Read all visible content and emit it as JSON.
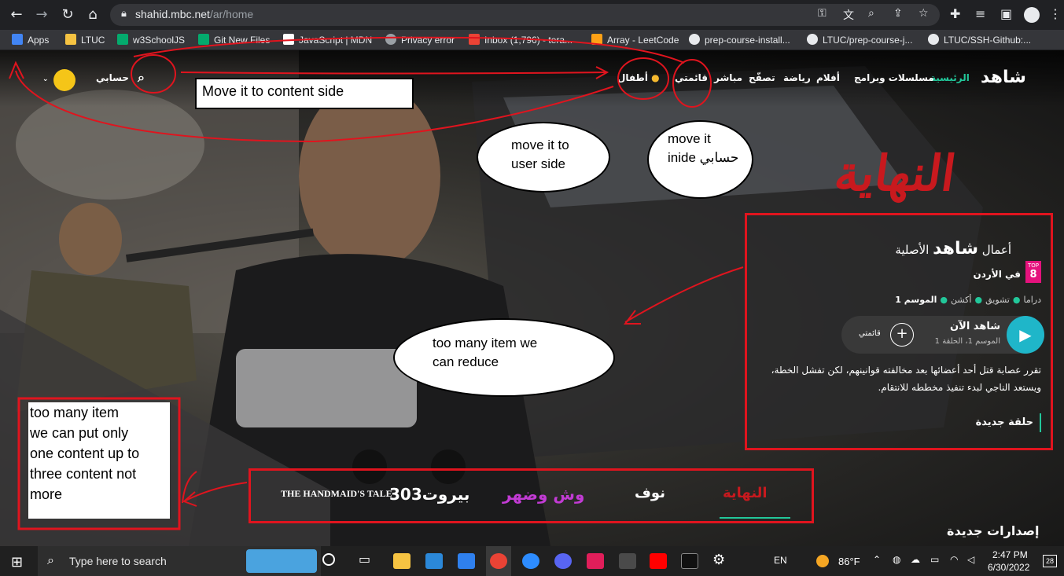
{
  "browser": {
    "url_host": "shahid.mbc.net",
    "url_path": "/ar/home",
    "bookmarks": [
      {
        "label": "Apps",
        "color": "#4285f4"
      },
      {
        "label": "LTUC",
        "color": "#f6c342"
      },
      {
        "label": "w3SchoolJS",
        "color": "#04aa6d"
      },
      {
        "label": "Git New Files",
        "color": "#04aa6d"
      },
      {
        "label": "JavaScript | MDN",
        "color": "#ffffff"
      },
      {
        "label": "Privacy error",
        "color": "#9aa0a6"
      },
      {
        "label": "Inbox (1,796) - tera...",
        "color": "#ea4335"
      },
      {
        "label": "Array - LeetCode",
        "color": "#ffa116"
      },
      {
        "label": "prep-course-install...",
        "color": "#e8eaed"
      },
      {
        "label": "LTUC/prep-course-j...",
        "color": "#e8eaed"
      },
      {
        "label": "LTUC/SSH-Github:...",
        "color": "#e8eaed"
      }
    ]
  },
  "site": {
    "logo": "شاهد",
    "nav": {
      "home": "الرئيسية",
      "series": "مسلسلات وبرامج",
      "movies": "أفلام",
      "sports": "رياضة",
      "browse": "تصفّح",
      "live": "مباشر",
      "mylist": "قائمتي",
      "kids": "أطفال"
    },
    "account": "حسابي",
    "show_title": "النهاية",
    "new_releases": "إصدارات جديدة"
  },
  "info": {
    "brand_prefix": "أعمال",
    "brand_logo": "شاهد",
    "brand_suffix": "الأصلية",
    "top_badge": "TOP",
    "top_rank": "8",
    "rank_text": "في الأردن",
    "season": "الموسم 1",
    "genres": [
      "أكشن",
      "تشويق",
      "دراما"
    ],
    "watch_label": "شاهد الآن",
    "watch_sub": "الموسم 1، الحلقة 1",
    "add_label": "قائمتي",
    "synopsis": "تقرر عصابة قتل أحد أعضائها بعد مخالفته قوانينهم، لكن تفشل الخطة، ويستعد الناجي لبدء تنفيذ مخططه للانتقام.",
    "new_episode": "حلقة جديدة"
  },
  "shows": [
    {
      "label": "THE HANDMAID'S TALE",
      "color": "#ffffff"
    },
    {
      "label": "بيروت303",
      "color": "#ffffff"
    },
    {
      "label": "وش وضهر",
      "color": "#c23bd4"
    },
    {
      "label": "نوف",
      "color": "#ffffff"
    },
    {
      "label": "النهاية",
      "color": "#c8191e"
    }
  ],
  "annotations": {
    "move_content": "Move it to content side",
    "move_user": [
      "move it to",
      "user side"
    ],
    "move_inside": [
      "move it",
      "inide حسابي"
    ],
    "reduce": [
      "too many item we",
      "can reduce"
    ],
    "limit": [
      "too many item",
      "we can put only",
      "one content up to",
      "three content not",
      "more"
    ]
  },
  "taskbar": {
    "search_placeholder": "Type here to search",
    "lang": "EN",
    "weather": "86°F",
    "time": "2:47 PM",
    "date": "6/30/2022",
    "notif_count": "28"
  }
}
